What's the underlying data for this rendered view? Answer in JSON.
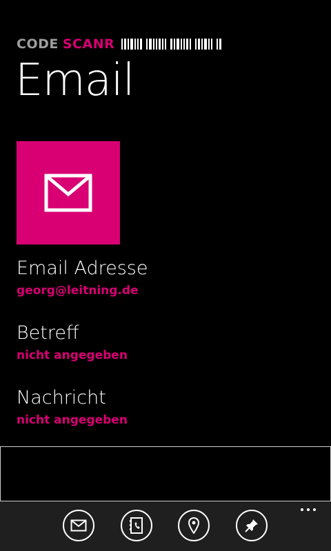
{
  "app": {
    "brand_code": "CODE",
    "brand_scanr": "SCANR"
  },
  "page": {
    "title": "Email"
  },
  "colors": {
    "accent": "#d80073",
    "background": "#000000",
    "appbar": "#1f1f1f"
  },
  "tile": {
    "icon": "envelope-icon"
  },
  "fields": [
    {
      "label": "Email Adresse",
      "value": "georg@leitning.de"
    },
    {
      "label": "Betreff",
      "value": "nicht angegeben"
    },
    {
      "label": "Nachricht",
      "value": "nicht angegeben"
    }
  ],
  "appbar": {
    "buttons": [
      {
        "icon": "send-email-icon"
      },
      {
        "icon": "add-contact-icon"
      },
      {
        "icon": "map-pin-icon"
      },
      {
        "icon": "pin-icon"
      }
    ],
    "more": "more-icon"
  }
}
